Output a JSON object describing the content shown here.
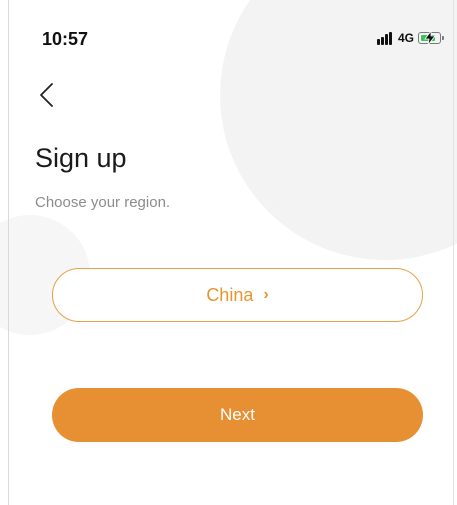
{
  "status_bar": {
    "time": "10:57",
    "network": "4G",
    "signal_icon": "signal-bars-icon",
    "battery_icon": "battery-charging-icon"
  },
  "header": {
    "back_icon": "chevron-left-icon"
  },
  "main": {
    "title": "Sign up",
    "subtitle": "Choose your region.",
    "region": {
      "value": "China",
      "chevron": "›"
    },
    "next_label": "Next"
  },
  "colors": {
    "accent": "#e68f33",
    "accent_text": "#e8952d",
    "battery_green": "#35c759"
  }
}
